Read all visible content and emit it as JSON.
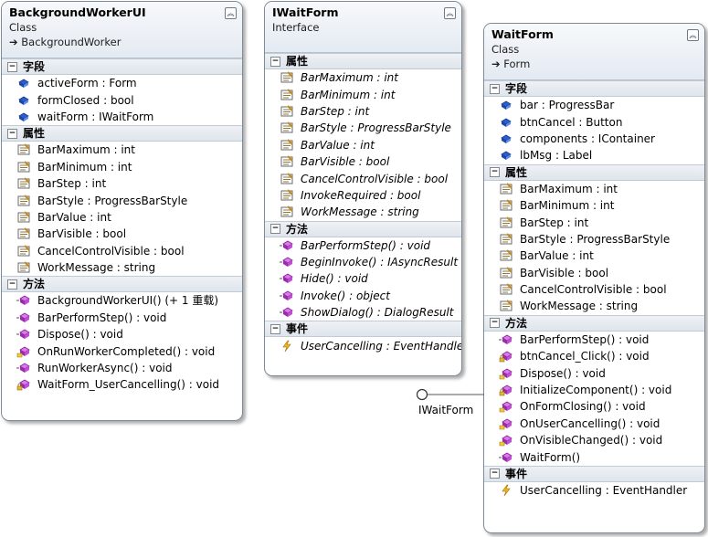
{
  "classes": [
    {
      "name": "BackgroundWorkerUI",
      "kind": "Class",
      "base": "BackgroundWorker",
      "sections": [
        {
          "title": "字段",
          "members": [
            {
              "icon": "field-icon",
              "text": "activeForm : Form"
            },
            {
              "icon": "field-icon",
              "text": "formClosed : bool"
            },
            {
              "icon": "field-icon",
              "text": "waitForm : IWaitForm"
            }
          ]
        },
        {
          "title": "属性",
          "members": [
            {
              "icon": "property-icon",
              "text": "BarMaximum : int"
            },
            {
              "icon": "property-icon",
              "text": "BarMinimum : int"
            },
            {
              "icon": "property-icon",
              "text": "BarStep : int"
            },
            {
              "icon": "property-icon",
              "text": "BarStyle : ProgressBarStyle"
            },
            {
              "icon": "property-icon",
              "text": "BarValue : int"
            },
            {
              "icon": "property-icon",
              "text": "BarVisible : bool"
            },
            {
              "icon": "property-icon",
              "text": "CancelControlVisible : bool"
            },
            {
              "icon": "property-icon",
              "text": "WorkMessage : string"
            }
          ]
        },
        {
          "title": "方法",
          "members": [
            {
              "icon": "method-icon",
              "text": "BackgroundWorkerUI() (+ 1 重载)"
            },
            {
              "icon": "method-icon",
              "text": "BarPerformStep() : void"
            },
            {
              "icon": "method-icon",
              "text": "Dispose() : void"
            },
            {
              "icon": "protected-method-icon",
              "text": "OnRunWorkerCompleted() : void"
            },
            {
              "icon": "method-icon",
              "text": "RunWorkerAsync() : void"
            },
            {
              "icon": "private-method-icon",
              "text": "WaitForm_UserCancelling() : void"
            }
          ]
        }
      ]
    },
    {
      "name": "IWaitForm",
      "kind": "Interface",
      "sections": [
        {
          "title": "属性",
          "members": [
            {
              "icon": "property-icon",
              "text": "BarMaximum : int"
            },
            {
              "icon": "property-icon",
              "text": "BarMinimum : int"
            },
            {
              "icon": "property-icon",
              "text": "BarStep : int"
            },
            {
              "icon": "property-icon",
              "text": "BarStyle : ProgressBarStyle"
            },
            {
              "icon": "property-icon",
              "text": "BarValue : int"
            },
            {
              "icon": "property-icon",
              "text": "BarVisible : bool"
            },
            {
              "icon": "property-icon",
              "text": "CancelControlVisible : bool"
            },
            {
              "icon": "property-icon",
              "text": "InvokeRequired : bool"
            },
            {
              "icon": "property-icon",
              "text": "WorkMessage : string"
            }
          ]
        },
        {
          "title": "方法",
          "members": [
            {
              "icon": "method-icon",
              "text": "BarPerformStep() : void"
            },
            {
              "icon": "method-icon",
              "text": "BeginInvoke() : IAsyncResult"
            },
            {
              "icon": "method-icon",
              "text": "Hide() : void"
            },
            {
              "icon": "method-icon",
              "text": "Invoke() : object"
            },
            {
              "icon": "method-icon",
              "text": "ShowDialog() : DialogResult"
            }
          ]
        },
        {
          "title": "事件",
          "members": [
            {
              "icon": "event-icon",
              "text": "UserCancelling : EventHandler"
            }
          ]
        }
      ]
    },
    {
      "name": "WaitForm",
      "kind": "Class",
      "base": "Form",
      "sections": [
        {
          "title": "字段",
          "members": [
            {
              "icon": "field-icon",
              "text": "bar : ProgressBar"
            },
            {
              "icon": "field-icon",
              "text": "btnCancel : Button"
            },
            {
              "icon": "field-icon",
              "text": "components : IContainer"
            },
            {
              "icon": "field-icon",
              "text": "lbMsg : Label"
            }
          ]
        },
        {
          "title": "属性",
          "members": [
            {
              "icon": "property-icon",
              "text": "BarMaximum : int"
            },
            {
              "icon": "property-icon",
              "text": "BarMinimum : int"
            },
            {
              "icon": "property-icon",
              "text": "BarStep : int"
            },
            {
              "icon": "property-icon",
              "text": "BarStyle : ProgressBarStyle"
            },
            {
              "icon": "property-icon",
              "text": "BarValue : int"
            },
            {
              "icon": "property-icon",
              "text": "BarVisible : bool"
            },
            {
              "icon": "property-icon",
              "text": "CancelControlVisible : bool"
            },
            {
              "icon": "property-icon",
              "text": "WorkMessage : string"
            }
          ]
        },
        {
          "title": "方法",
          "members": [
            {
              "icon": "method-icon",
              "text": "BarPerformStep() : void"
            },
            {
              "icon": "private-method-icon",
              "text": "btnCancel_Click() : void"
            },
            {
              "icon": "protected-method-icon",
              "text": "Dispose() : void"
            },
            {
              "icon": "private-method-icon",
              "text": "InitializeComponent() : void"
            },
            {
              "icon": "protected-method-icon",
              "text": "OnFormClosing() : void"
            },
            {
              "icon": "protected-method-icon",
              "text": "OnUserCancelling() : void"
            },
            {
              "icon": "protected-method-icon",
              "text": "OnVisibleChanged() : void"
            },
            {
              "icon": "method-icon",
              "text": "WaitForm()"
            }
          ]
        },
        {
          "title": "事件",
          "members": [
            {
              "icon": "event-icon",
              "text": "UserCancelling : EventHandler"
            }
          ]
        }
      ]
    }
  ],
  "lollipop": {
    "label": "IWaitForm"
  },
  "colors": {
    "field": "#2a5fd0",
    "property": "#7a6a3a",
    "method": "#b02cc4",
    "event": "#e0a010",
    "border": "#808a96"
  }
}
